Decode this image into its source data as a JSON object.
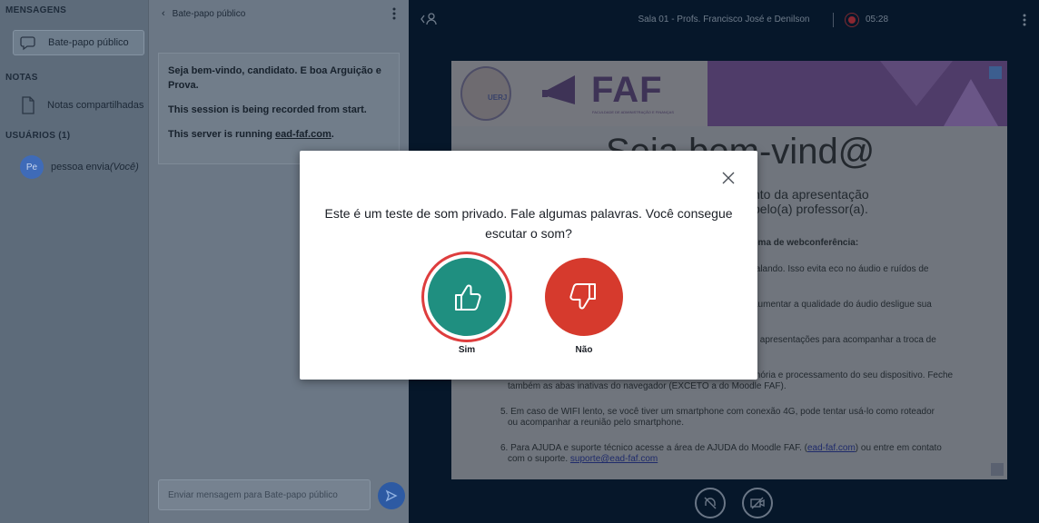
{
  "userlist": {
    "messages_title": "MENSAGENS",
    "public_chat": "Bate-papo público",
    "notes_title": "NOTAS",
    "shared_notes": "Notas compartilhadas",
    "users_title": "USUÁRIOS (1)",
    "user": {
      "initials": "Pe",
      "name": "pessoa envia ",
      "you": "(Você)"
    }
  },
  "chat": {
    "header": "Bate-papo público",
    "messages": [
      "Seja bem-vindo, candidato. E boa Arguição e Prova.",
      "This session is being recorded from start.",
      "This server is running "
    ],
    "server_link": "ead-faf.com",
    "input_placeholder": "Enviar mensagem para Bate-papo público"
  },
  "topbar": {
    "room_title": "Sala 01 - Profs. Francisco José e Denilson",
    "recording_time": "05:28"
  },
  "slide": {
    "logo_text": "FAF",
    "logo_subtitle": "FACULDADE DE ADMINISTRAÇÃO E FINANÇAS",
    "seal_text": "UERJ",
    "title": "Seja bem-vind@",
    "line1": "nto da apresentação",
    "line2": "pelo(a) professor(a).",
    "line3": "ema de webconferência:",
    "line4": "falando. Isso evita eco no áudio e ruídos de",
    "line5": "aumentar a qualidade do áudio desligue sua",
    "line6": "s apresentações para acompanhar a troca de",
    "line7": "mória e processamento do seu dispositivo. Feche",
    "line8": "também as abas inativas do navegador (EXCETO a do Moodle FAF).",
    "line9": "5. Em caso de WIFI lento, se você tiver um smartphone com conexão 4G, pode tentar usá-lo como roteador",
    "line10": "ou acompanhar a reunião pelo smartphone.",
    "line11": "6. Para AJUDA e suporte técnico acesse a área de AJUDA do Moodle FAF. (",
    "line11_link": "ead-faf.com",
    "line11_end": ") ou entre em contato",
    "line12": "com o suporte. ",
    "line12_link": "suporte@ead-faf.com"
  },
  "modal": {
    "question": "Este é um teste de som privado. Fale algumas palavras. Você consegue escutar o som?",
    "yes": "Sim",
    "no": "Não"
  },
  "colors": {
    "yes": "#1f8f80",
    "no": "#d63a2d",
    "focus_ring": "#de3d3d",
    "send": "#2d5aa3"
  }
}
